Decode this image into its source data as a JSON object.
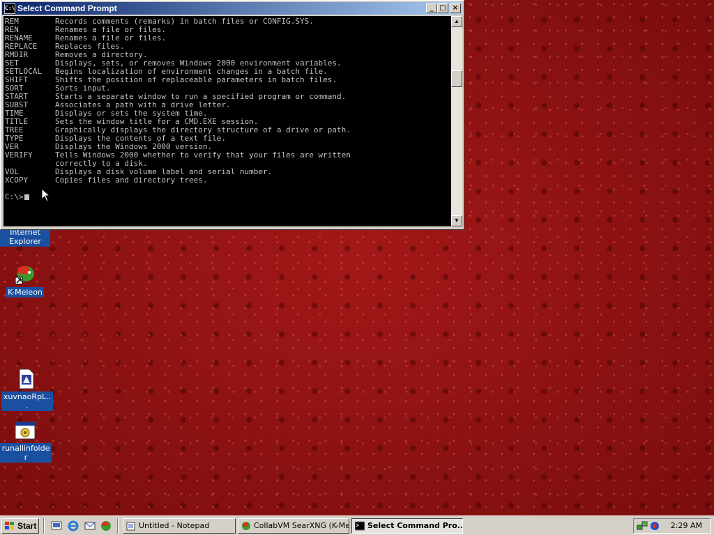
{
  "window": {
    "title": "Select Command Prompt",
    "minimize": "_",
    "maximize": "□",
    "close": "×",
    "icon_text": "C:\\"
  },
  "console": {
    "lines": [
      {
        "cmd": "REM",
        "desc": "Records comments (remarks) in batch files or CONFIG.SYS."
      },
      {
        "cmd": "REN",
        "desc": "Renames a file or files."
      },
      {
        "cmd": "RENAME",
        "desc": "Renames a file or files."
      },
      {
        "cmd": "REPLACE",
        "desc": "Replaces files."
      },
      {
        "cmd": "RMDIR",
        "desc": "Removes a directory."
      },
      {
        "cmd": "SET",
        "desc": "Displays, sets, or removes Windows 2000 environment variables."
      },
      {
        "cmd": "SETLOCAL",
        "desc": "Begins localization of environment changes in a batch file."
      },
      {
        "cmd": "SHIFT",
        "desc": "Shifts the position of replaceable parameters in batch files."
      },
      {
        "cmd": "SORT",
        "desc": "Sorts input."
      },
      {
        "cmd": "START",
        "desc": "Starts a separate window to run a specified program or command."
      },
      {
        "cmd": "SUBST",
        "desc": "Associates a path with a drive letter."
      },
      {
        "cmd": "TIME",
        "desc": "Displays or sets the system time."
      },
      {
        "cmd": "TITLE",
        "desc": "Sets the window title for a CMD.EXE session."
      },
      {
        "cmd": "TREE",
        "desc": "Graphically displays the directory structure of a drive or path."
      },
      {
        "cmd": "TYPE",
        "desc": "Displays the contents of a text file."
      },
      {
        "cmd": "VER",
        "desc": "Displays the Windows 2000 version."
      },
      {
        "cmd": "VERIFY",
        "desc": "Tells Windows 2000 whether to verify that your files are written"
      },
      {
        "cmd": "",
        "desc": "correctly to a disk."
      },
      {
        "cmd": "VOL",
        "desc": "Displays a disk volume label and serial number."
      },
      {
        "cmd": "XCOPY",
        "desc": "Copies files and directory trees."
      }
    ],
    "prompt": "C:\\>"
  },
  "desktop_icons": [
    {
      "label": "Internet Explorer",
      "icon": "internet-explorer-icon"
    },
    {
      "label": "K-Meleon",
      "icon": "k-meleon-icon"
    },
    {
      "label": "xuvnaoRpL...",
      "icon": "document-icon"
    },
    {
      "label": "runallinfolder",
      "icon": "program-icon"
    }
  ],
  "taskbar": {
    "start_label": "Start",
    "tasks": [
      {
        "label": "Untitled - Notepad",
        "icon": "notepad-icon"
      },
      {
        "label": "CollabVM SearXNG (K-Mel...",
        "icon": "k-meleon-icon"
      },
      {
        "label": "Select Command Pro...",
        "icon": "cmd-icon",
        "active": true
      }
    ],
    "clock": "2:29 AM"
  },
  "colors": {
    "titlebar_start": "#0a246a",
    "titlebar_end": "#a6caf0",
    "desktop": "#8e1212",
    "console_bg": "#000000",
    "console_fg": "#c0c0c0",
    "icon_label_bg": "#1a50a0"
  }
}
